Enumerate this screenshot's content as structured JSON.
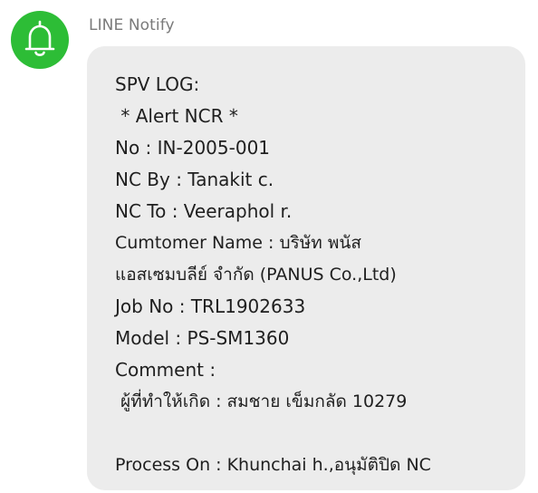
{
  "sender": {
    "name": "LINE Notify",
    "avatar_icon": "bell-icon",
    "avatar_color": "#2dbd36"
  },
  "message": {
    "lines": [
      "SPV LOG:",
      " * Alert NCR *",
      "No : IN-2005-001",
      "NC By : Tanakit c.",
      "NC To : Veeraphol r.",
      "Cumtomer Name : บริษัท พนัส",
      "แอสเซมบลีย์ จำกัด (PANUS Co.,Ltd)",
      "Job No : TRL1902633",
      "Model : PS-SM1360",
      "Comment :",
      " ผู้ที่ทำให้เกิด : สมชาย เข็มกลัด 10279",
      "",
      "Process On : Khunchai h.,อนุมัติปิด NC"
    ]
  }
}
